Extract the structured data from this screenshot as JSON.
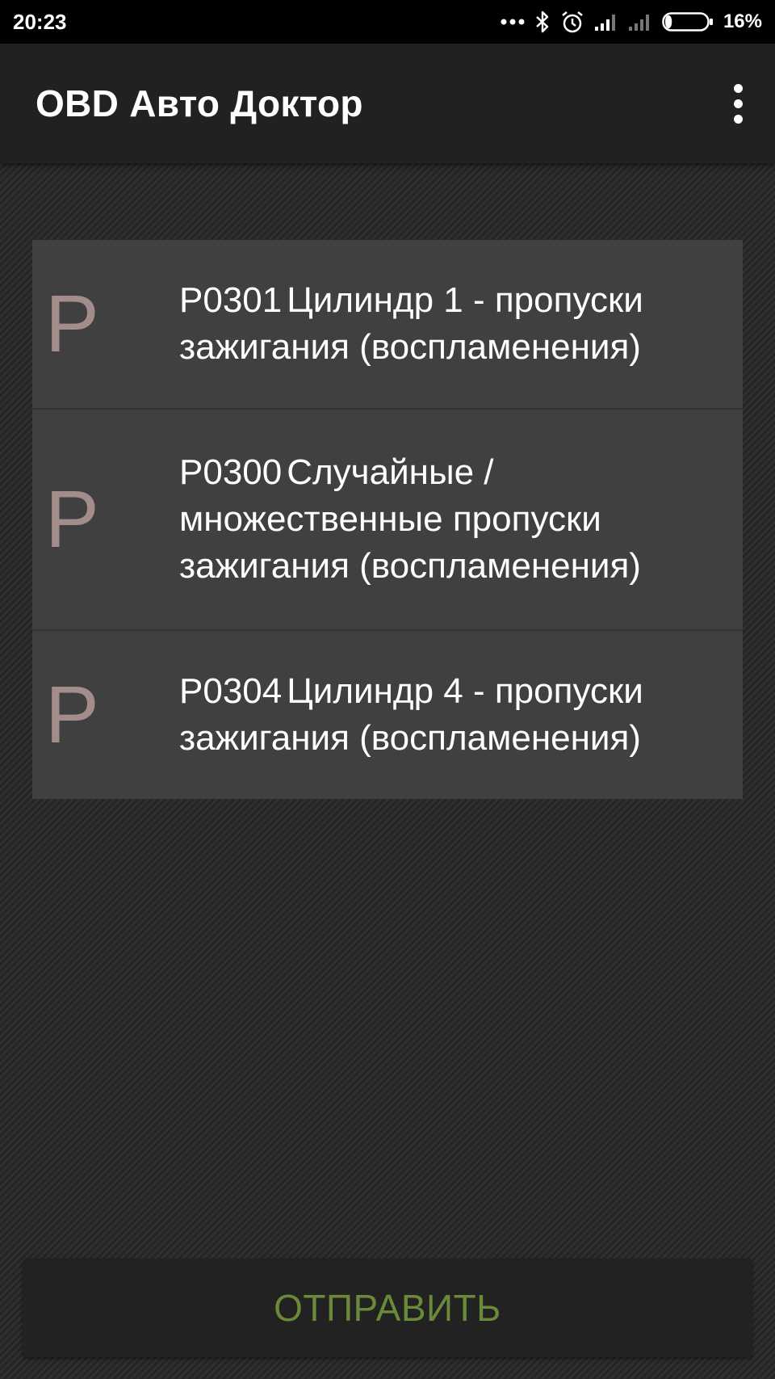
{
  "status_bar": {
    "time": "20:23",
    "battery_percent": "16%",
    "battery_level": 0.16,
    "icons": [
      "more-dots-icon",
      "bluetooth-icon",
      "alarm-icon",
      "signal-icon",
      "signal-empty-icon",
      "battery-icon"
    ]
  },
  "app_bar": {
    "title": "OBD Авто Доктор",
    "menu_icon": "overflow-menu-icon"
  },
  "codes": [
    {
      "letter": "P",
      "code": "P0301",
      "description": "Цилиндр 1 - пропуски зажигания (воспламенения)"
    },
    {
      "letter": "P",
      "code": "P0300",
      "description": "Случайные / множественные пропуски зажигания (воспламенения)"
    },
    {
      "letter": "P",
      "code": "P0304",
      "description": "Цилиндр 4 - пропуски зажигания (воспламенения)"
    }
  ],
  "send_button": {
    "label": "ОТПРАВИТЬ"
  },
  "colors": {
    "app_bar": "#212121",
    "list_item": "#404040",
    "letter": "#a28d8a",
    "send_label": "#6a8a3a"
  }
}
